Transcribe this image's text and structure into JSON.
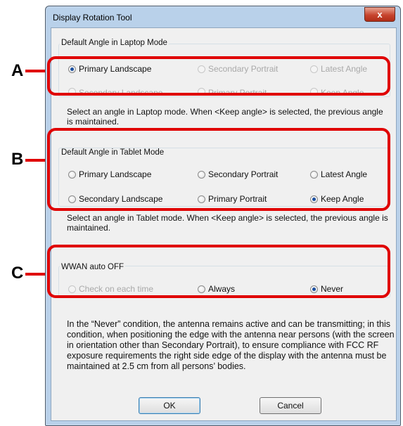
{
  "window": {
    "title": "Display Rotation Tool",
    "close_label": "x"
  },
  "laptop_group": {
    "title": "Default Angle in Laptop Mode",
    "options": [
      {
        "label": "Primary Landscape",
        "selected": true,
        "disabled": false
      },
      {
        "label": "Secondary Portrait",
        "selected": false,
        "disabled": true
      },
      {
        "label": "Latest Angle",
        "selected": false,
        "disabled": true
      },
      {
        "label": "Secondary Landscape",
        "selected": false,
        "disabled": true
      },
      {
        "label": "Primary Portrait",
        "selected": false,
        "disabled": true
      },
      {
        "label": "Keep Angle",
        "selected": false,
        "disabled": true
      }
    ],
    "description": "Select an angle in Laptop mode. When <Keep angle> is selected, the previous angle is maintained."
  },
  "tablet_group": {
    "title": "Default Angle in Tablet Mode",
    "options": [
      {
        "label": "Primary Landscape",
        "selected": false,
        "disabled": false
      },
      {
        "label": "Secondary Portrait",
        "selected": false,
        "disabled": false
      },
      {
        "label": "Latest Angle",
        "selected": false,
        "disabled": false
      },
      {
        "label": "Secondary Landscape",
        "selected": false,
        "disabled": false
      },
      {
        "label": "Primary Portrait",
        "selected": false,
        "disabled": false
      },
      {
        "label": "Keep Angle",
        "selected": true,
        "disabled": false
      }
    ],
    "description": "Select an angle in Tablet mode. When <Keep angle> is selected, the previous angle is maintained."
  },
  "wwan_group": {
    "title": "WWAN auto OFF",
    "options": [
      {
        "label": "Check on each time",
        "selected": false,
        "disabled": true
      },
      {
        "label": "Always",
        "selected": false,
        "disabled": false
      },
      {
        "label": "Never",
        "selected": true,
        "disabled": false
      }
    ]
  },
  "note": "In the “Never” condition, the antenna remains active and can be transmitting; in this condition, when positioning the edge with the antenna near persons (with the screen in orientation other than Secondary Portrait), to ensure compliance with FCC RF exposure requirements the right side edge of the display with the antenna must be maintained at 2.5 cm from all persons’ bodies.",
  "buttons": {
    "ok": "OK",
    "cancel": "Cancel"
  },
  "callouts": {
    "a": "A",
    "b": "B",
    "c": "C",
    "color": "#e00000"
  }
}
